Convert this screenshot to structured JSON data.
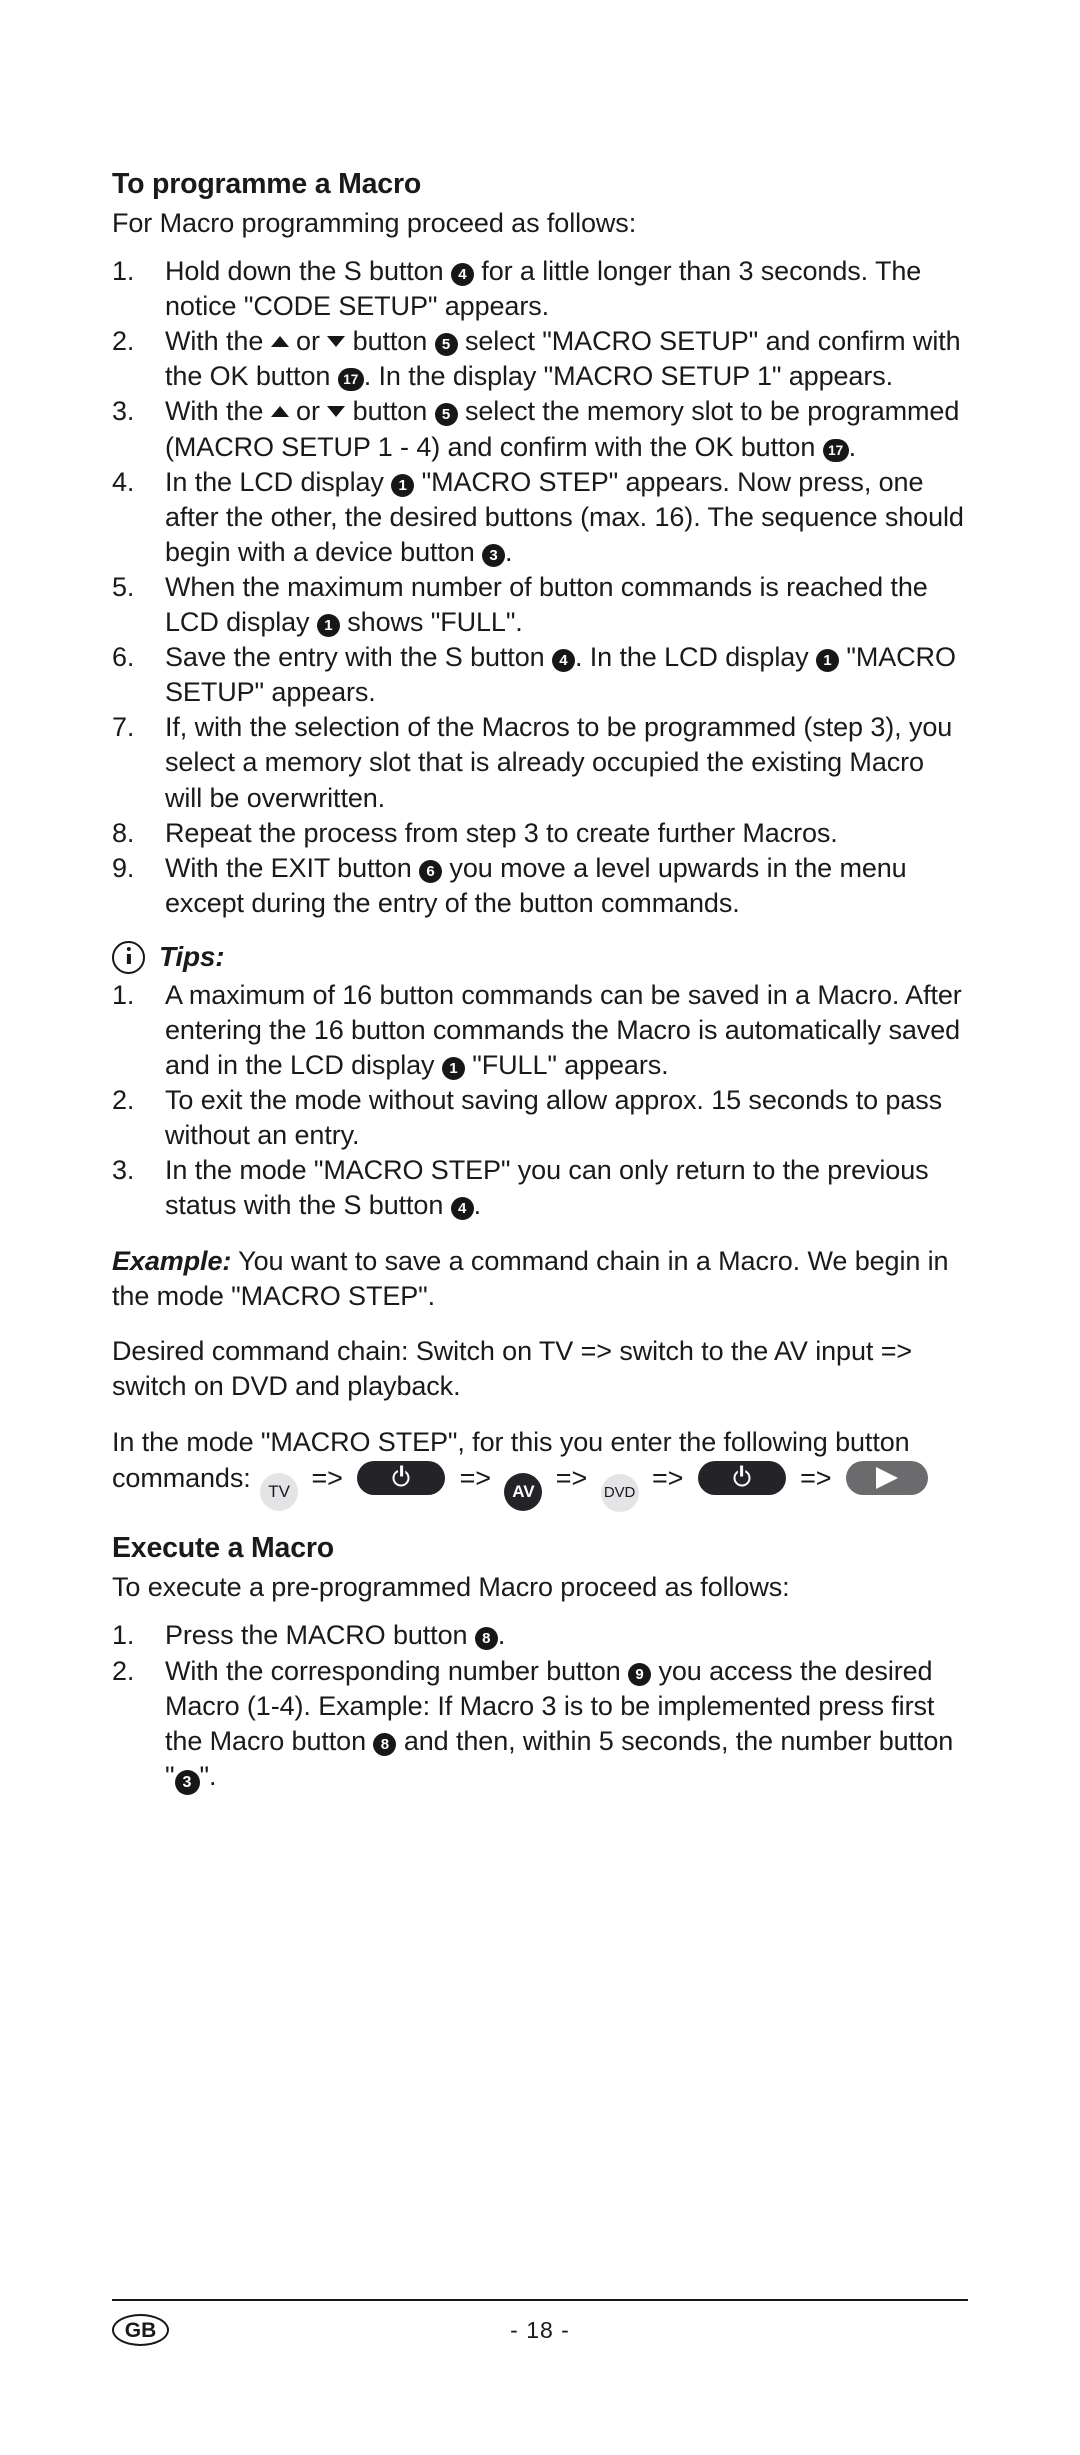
{
  "document": {
    "language_badge": "GB",
    "page_number": "- 18 -"
  },
  "sections": {
    "programme_macro": {
      "heading": "To programme a Macro",
      "lead": "For Macro programming proceed as follows:",
      "steps": [
        {
          "number": "1.",
          "parts": [
            {
              "t": "text",
              "v": "Hold down the S button "
            },
            {
              "t": "ref",
              "v": "4"
            },
            {
              "t": "text",
              "v": " for a little longer than 3 seconds. The notice \"CODE SETUP\" appears."
            }
          ]
        },
        {
          "number": "2.",
          "parts": [
            {
              "t": "text",
              "v": "With the "
            },
            {
              "t": "tri-up"
            },
            {
              "t": "text",
              "v": " or "
            },
            {
              "t": "tri-down"
            },
            {
              "t": "text",
              "v": " button "
            },
            {
              "t": "ref",
              "v": "5"
            },
            {
              "t": "text",
              "v": " select \"MACRO SETUP\" and confirm with the OK button "
            },
            {
              "t": "ref",
              "v": "17"
            },
            {
              "t": "text",
              "v": ". In the display \"MACRO SETUP 1\" appears."
            }
          ]
        },
        {
          "number": "3.",
          "parts": [
            {
              "t": "text",
              "v": "With the "
            },
            {
              "t": "tri-up"
            },
            {
              "t": "text",
              "v": " or "
            },
            {
              "t": "tri-down"
            },
            {
              "t": "text",
              "v": " button "
            },
            {
              "t": "ref",
              "v": "5"
            },
            {
              "t": "text",
              "v": " select the memory slot to be programmed (MACRO SETUP 1 - 4) and confirm with the OK button "
            },
            {
              "t": "ref",
              "v": "17"
            },
            {
              "t": "text",
              "v": "."
            }
          ]
        },
        {
          "number": "4.",
          "parts": [
            {
              "t": "text",
              "v": "In the LCD display "
            },
            {
              "t": "ref",
              "v": "1"
            },
            {
              "t": "text",
              "v": " \"MACRO STEP\" appears. Now press, one after the other, the desired buttons (max. 16). The sequence should begin with a device button "
            },
            {
              "t": "ref",
              "v": "3"
            },
            {
              "t": "text",
              "v": "."
            }
          ]
        },
        {
          "number": "5.",
          "parts": [
            {
              "t": "text",
              "v": "When the maximum number of button commands is reached the LCD display "
            },
            {
              "t": "ref",
              "v": "1"
            },
            {
              "t": "text",
              "v": " shows \"FULL\"."
            }
          ]
        },
        {
          "number": "6.",
          "parts": [
            {
              "t": "text",
              "v": "Save the entry with the S button "
            },
            {
              "t": "ref",
              "v": "4"
            },
            {
              "t": "text",
              "v": ". In the LCD display "
            },
            {
              "t": "ref",
              "v": "1"
            },
            {
              "t": "text",
              "v": " \"MACRO SETUP\" appears."
            }
          ]
        },
        {
          "number": "7.",
          "parts": [
            {
              "t": "text",
              "v": "If, with the selection of the Macros to be programmed (step 3), you select a memory slot that is already occupied the existing Macro will be overwritten."
            }
          ]
        },
        {
          "number": "8.",
          "parts": [
            {
              "t": "text",
              "v": "Repeat the process from step 3 to create further Macros."
            }
          ]
        },
        {
          "number": "9.",
          "parts": [
            {
              "t": "text",
              "v": "With the EXIT button "
            },
            {
              "t": "ref",
              "v": "6"
            },
            {
              "t": "text",
              "v": " you move a level upwards in the menu except during the entry of the button commands."
            }
          ]
        }
      ]
    },
    "tips": {
      "icon": "info-icon",
      "heading": "Tips:",
      "steps": [
        {
          "number": "1.",
          "parts": [
            {
              "t": "text",
              "v": "A maximum of 16 button commands can be saved in a Macro. After entering the 16 button commands the Macro is automatically saved and in the LCD display "
            },
            {
              "t": "ref",
              "v": "1"
            },
            {
              "t": "text",
              "v": " \"FULL\" appears."
            }
          ]
        },
        {
          "number": "2.",
          "parts": [
            {
              "t": "text",
              "v": "To exit the mode without saving allow approx. 15 seconds to pass without an entry."
            }
          ]
        },
        {
          "number": "3.",
          "parts": [
            {
              "t": "text",
              "v": "In the mode \"MACRO STEP\" you can only return to the previous status with the S button "
            },
            {
              "t": "ref",
              "v": "4"
            },
            {
              "t": "text",
              "v": "."
            }
          ]
        }
      ]
    },
    "example": {
      "label": "Example:",
      "intro": " You want to save a command chain in a Macro. We begin in the mode \"MACRO STEP\".",
      "chain": "Desired command chain: Switch on TV => switch to the AV input => switch on DVD and playback.",
      "sequence_intro": "In the mode \"MACRO STEP\", for this you enter the following button commands: ",
      "sequence": [
        {
          "kind": "key-circle-light",
          "label": "TV"
        },
        {
          "kind": "arrow",
          "label": "=>"
        },
        {
          "kind": "key-pill-power",
          "label": ""
        },
        {
          "kind": "arrow",
          "label": "=>"
        },
        {
          "kind": "key-circle-dark",
          "label": "AV"
        },
        {
          "kind": "arrow",
          "label": "=>"
        },
        {
          "kind": "key-circle-light",
          "label": "DVD"
        },
        {
          "kind": "arrow",
          "label": "=>"
        },
        {
          "kind": "key-pill-power",
          "label": ""
        },
        {
          "kind": "arrow",
          "label": "=>"
        },
        {
          "kind": "key-pill-play",
          "label": ""
        }
      ]
    },
    "execute_macro": {
      "heading": "Execute a Macro",
      "lead": "To execute a pre-programmed Macro proceed as follows:",
      "steps": [
        {
          "number": "1.",
          "parts": [
            {
              "t": "text",
              "v": "Press the MACRO button "
            },
            {
              "t": "ref",
              "v": "8"
            },
            {
              "t": "text",
              "v": "."
            }
          ]
        },
        {
          "number": "2.",
          "parts": [
            {
              "t": "text",
              "v": "With the corresponding number button "
            },
            {
              "t": "ref",
              "v": "9"
            },
            {
              "t": "text",
              "v": " you access the desired Macro (1-4). Example: If Macro 3 is to be implemented press first the Macro button "
            },
            {
              "t": "ref",
              "v": "8"
            },
            {
              "t": "text",
              "v": " and then, within 5 seconds, the number button \""
            },
            {
              "t": "ref-q",
              "v": "3"
            },
            {
              "t": "text",
              "v": "\"."
            }
          ]
        }
      ]
    }
  }
}
